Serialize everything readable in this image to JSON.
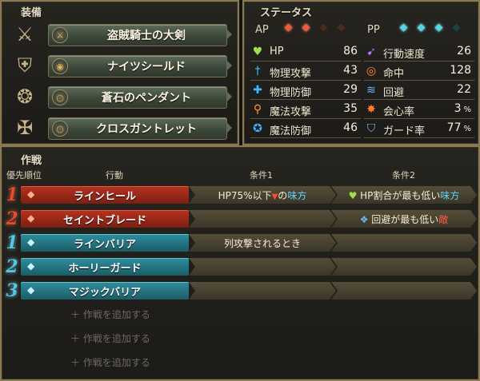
{
  "equipment": {
    "title": "装備",
    "items": [
      {
        "name": "盗賊騎士の大剣",
        "type_icon": "sword-icon",
        "big_icon": "greatsword-icon"
      },
      {
        "name": "ナイツシールド",
        "type_icon": "shield-icon",
        "big_icon": "round-shield-icon"
      },
      {
        "name": "蒼石のペンダント",
        "type_icon": "accessory-icon",
        "big_icon": "pendant-icon"
      },
      {
        "name": "クロスガントレット",
        "type_icon": "accessory-icon",
        "big_icon": "gauntlet-icon"
      }
    ]
  },
  "status": {
    "title": "ステータス",
    "ap_label": "AP",
    "pp_label": "PP",
    "ap_filled": 2,
    "ap_total": 4,
    "pp_filled": 3,
    "pp_total": 4,
    "left": [
      {
        "label": "HP",
        "value": "86",
        "icon": "heart-icon",
        "color": "#9ee04a"
      },
      {
        "label": "物理攻撃",
        "value": "43",
        "icon": "sword-icon",
        "color": "#3fb6ff"
      },
      {
        "label": "物理防御",
        "value": "29",
        "icon": "armor-icon",
        "color": "#3fb6ff"
      },
      {
        "label": "魔法攻撃",
        "value": "35",
        "icon": "staff-icon",
        "color": "#ff9a3a"
      },
      {
        "label": "魔法防御",
        "value": "46",
        "icon": "magic-shield-icon",
        "color": "#3fb6ff"
      }
    ],
    "right": [
      {
        "label": "行動速度",
        "value": "26",
        "unit": "",
        "icon": "speed-icon",
        "color": "#b87cff"
      },
      {
        "label": "命中",
        "value": "128",
        "unit": "",
        "icon": "target-icon",
        "color": "#ff8a3a"
      },
      {
        "label": "回避",
        "value": "22",
        "unit": "",
        "icon": "evade-icon",
        "color": "#6fb8ff"
      },
      {
        "label": "会心率",
        "value": "3",
        "unit": "%",
        "icon": "critical-icon",
        "color": "#ff7a2a"
      },
      {
        "label": "ガード率",
        "value": "77",
        "unit": "%",
        "icon": "guard-icon",
        "color": "#6fb8ff"
      }
    ]
  },
  "tactics": {
    "title": "作戦",
    "headers": {
      "priority": "優先順位",
      "action": "行動",
      "cond1": "条件1",
      "cond2": "条件2"
    },
    "rows": [
      {
        "priority": "1",
        "kind": "ap",
        "action": "ラインヒール",
        "cond1": {
          "pre": "HP75%以下",
          "mid": "▼",
          "mid2": "の",
          "hl": "味方",
          "hlc": "blue"
        },
        "cond2": {
          "icon": "♥",
          "pre": " HP割合が最も低い",
          "hl": "味方",
          "hlc": "blue"
        }
      },
      {
        "priority": "2",
        "kind": "ap",
        "action": "セイントブレード",
        "cond1": {
          "pre": "",
          "mid": "",
          "mid2": "",
          "hl": "",
          "hlc": ""
        },
        "cond2": {
          "icon": "❖",
          "pre": " 回避が最も低い",
          "hl": "敵",
          "hlc": "red"
        }
      },
      {
        "priority": "1",
        "kind": "pp",
        "action": "ラインバリア",
        "cond1": {
          "pre": "列攻撃されるとき",
          "mid": "",
          "mid2": "",
          "hl": "",
          "hlc": ""
        },
        "cond2": {
          "icon": "",
          "pre": "",
          "hl": "",
          "hlc": ""
        }
      },
      {
        "priority": "2",
        "kind": "pp",
        "action": "ホーリーガード",
        "cond1": {
          "pre": "",
          "mid": "",
          "mid2": "",
          "hl": "",
          "hlc": ""
        },
        "cond2": {
          "icon": "",
          "pre": "",
          "hl": "",
          "hlc": ""
        }
      },
      {
        "priority": "3",
        "kind": "pp",
        "action": "マジックバリア",
        "cond1": {
          "pre": "",
          "mid": "",
          "mid2": "",
          "hl": "",
          "hlc": ""
        },
        "cond2": {
          "icon": "",
          "pre": "",
          "hl": "",
          "hlc": ""
        }
      }
    ],
    "add_label": "＋ 作戦を追加する",
    "add_count": 3
  }
}
